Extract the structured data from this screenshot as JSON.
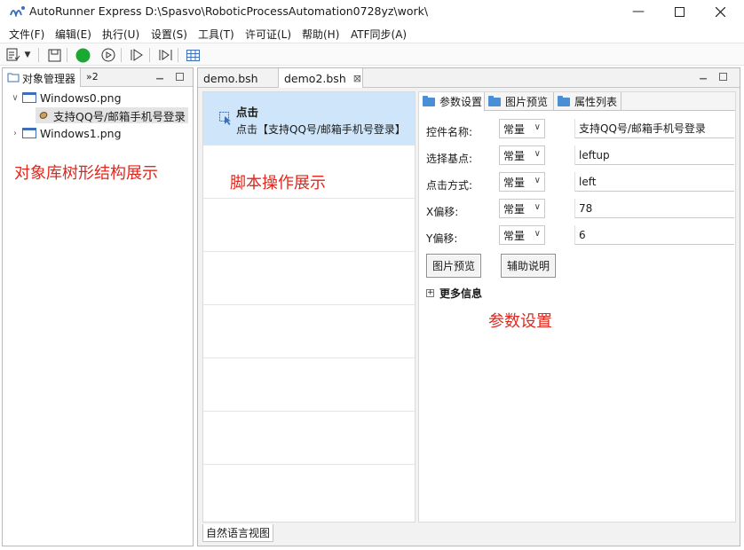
{
  "window": {
    "title": "AutoRunner Express   D:\\Spasvo\\RoboticProcessAutomation0728yz\\work\\"
  },
  "menu": [
    "文件(F)",
    "编辑(E)",
    "执行(U)",
    "设置(S)",
    "工具(T)",
    "许可证(L)",
    "帮助(H)",
    "ATF同步(A)"
  ],
  "left_panel": {
    "tab_label": "对象管理器",
    "overflow_label": "»2",
    "tree": {
      "item0": "Windows0.png",
      "item0_child": "支持QQ号/邮箱手机号登录",
      "item1": "Windows1.png"
    },
    "caption": "对象库树形结构展示"
  },
  "editor_tabs": [
    "demo.bsh",
    "demo2.bsh"
  ],
  "script": {
    "step_title": "点击",
    "step_desc": "点击【支持QQ号/邮箱手机号登录】",
    "caption": "脚本操作展示",
    "bottom_tab": "自然语言视图"
  },
  "params": {
    "tabs": [
      "参数设置",
      "图片预览",
      "属性列表"
    ],
    "rows": [
      {
        "label": "控件名称:",
        "mode": "常量",
        "value": "支持QQ号/邮箱手机号登录"
      },
      {
        "label": "选择基点:",
        "mode": "常量",
        "value": "leftup"
      },
      {
        "label": "点击方式:",
        "mode": "常量",
        "value": "left"
      },
      {
        "label": "X偏移:",
        "mode": "常量",
        "value": "78"
      },
      {
        "label": "Y偏移:",
        "mode": "常量",
        "value": "6"
      }
    ],
    "btn_preview": "图片预览",
    "btn_help": "辅助说明",
    "more_info": "更多信息",
    "caption": "参数设置"
  },
  "colors": {
    "accent_blue": "#4a8fd6",
    "caption_red": "#e0281e",
    "run_green": "#1aa832",
    "selected_row": "#cfe6fa"
  }
}
